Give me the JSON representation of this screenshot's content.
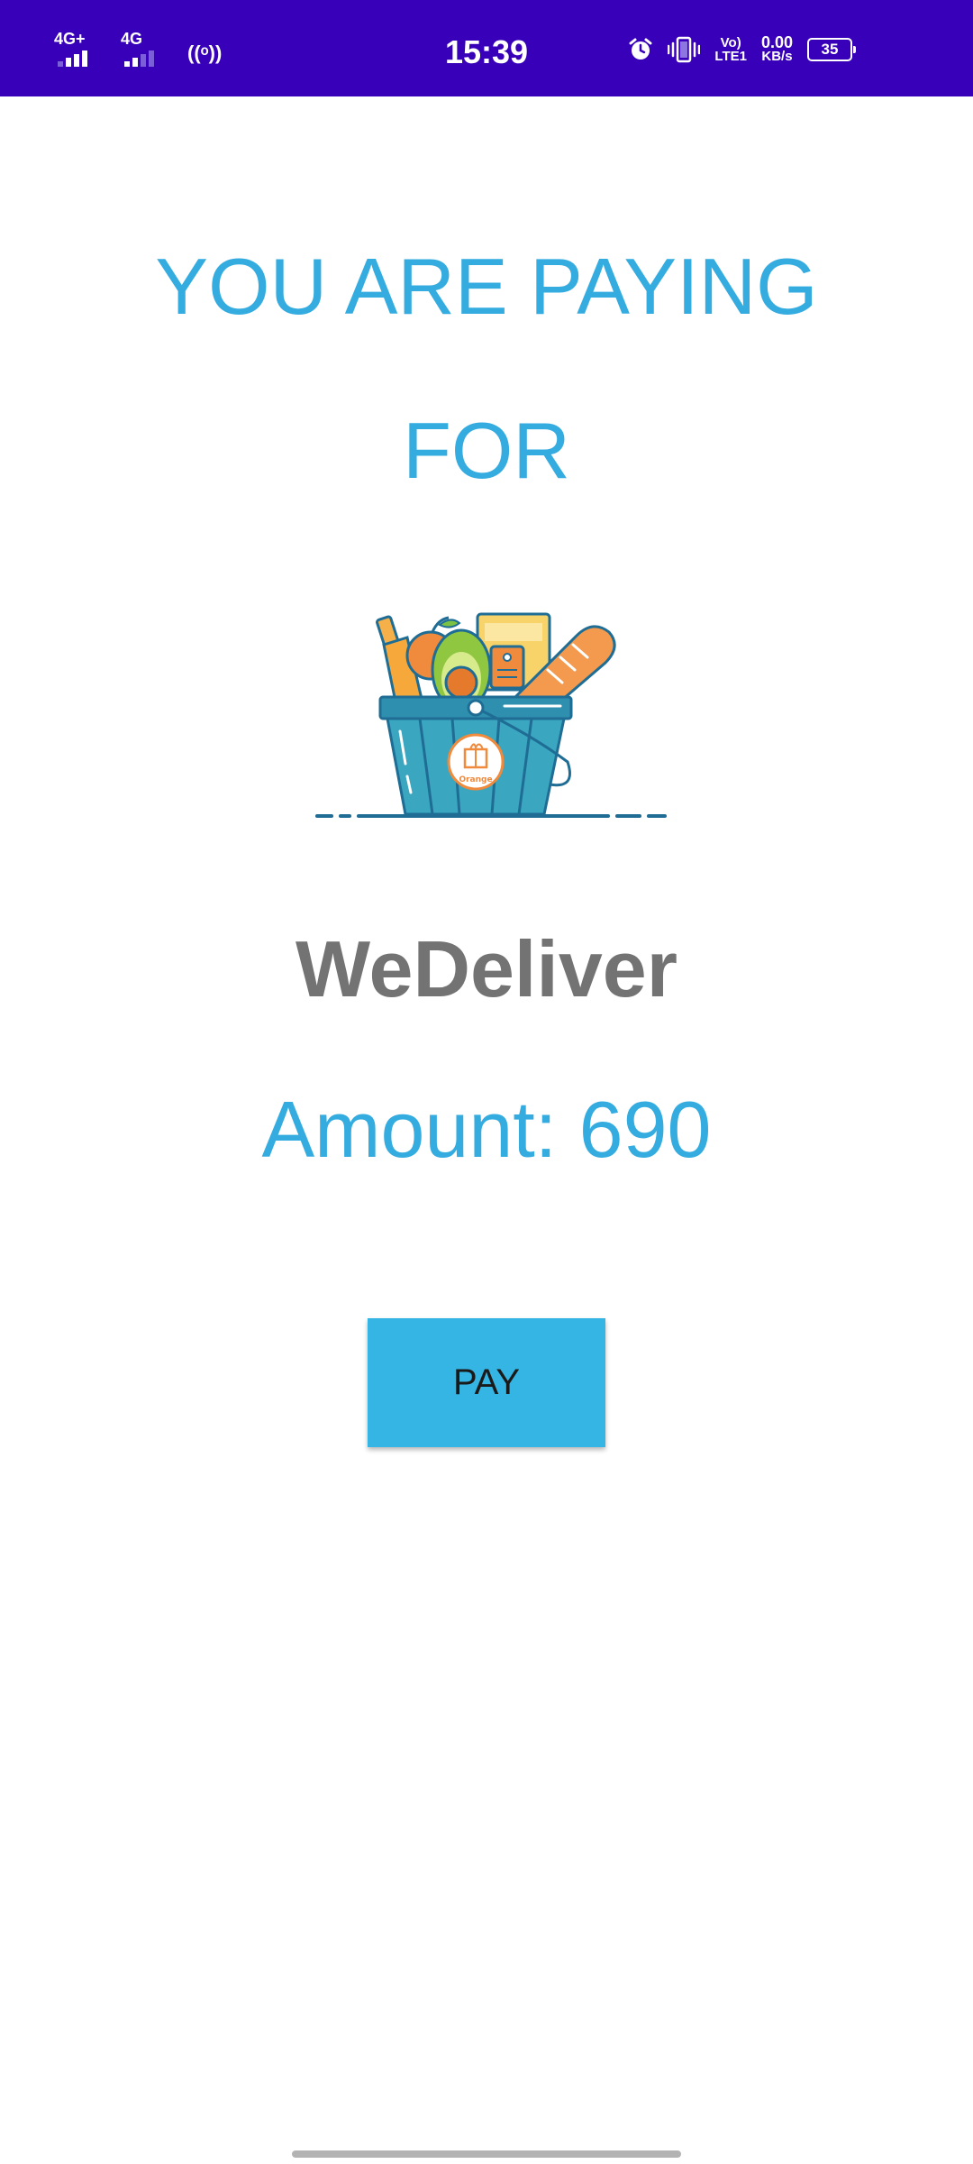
{
  "status_bar": {
    "time": "15:39",
    "sim1_network": "4G+",
    "sim2_network": "4G",
    "hotspot": "((ᵒ))",
    "volte_top": "Vo)",
    "volte_bottom": "LTE1",
    "speed_value": "0.00",
    "speed_unit": "KB/s",
    "battery_level": "35",
    "background_color": "#3800b8"
  },
  "page": {
    "heading_line_1": "YOU ARE PAYING",
    "heading_line_2": "FOR",
    "image_label": "Orange",
    "merchant_name": "WeDeliver",
    "amount_label": "Amount:",
    "amount_value": "690",
    "pay_button_label": "PAY",
    "accent_color": "#35ace0",
    "button_color": "#35b5e4"
  },
  "icons": {
    "alarm": "alarm-icon",
    "vibrate": "vibrate-icon",
    "basket": "grocery-basket-icon"
  }
}
